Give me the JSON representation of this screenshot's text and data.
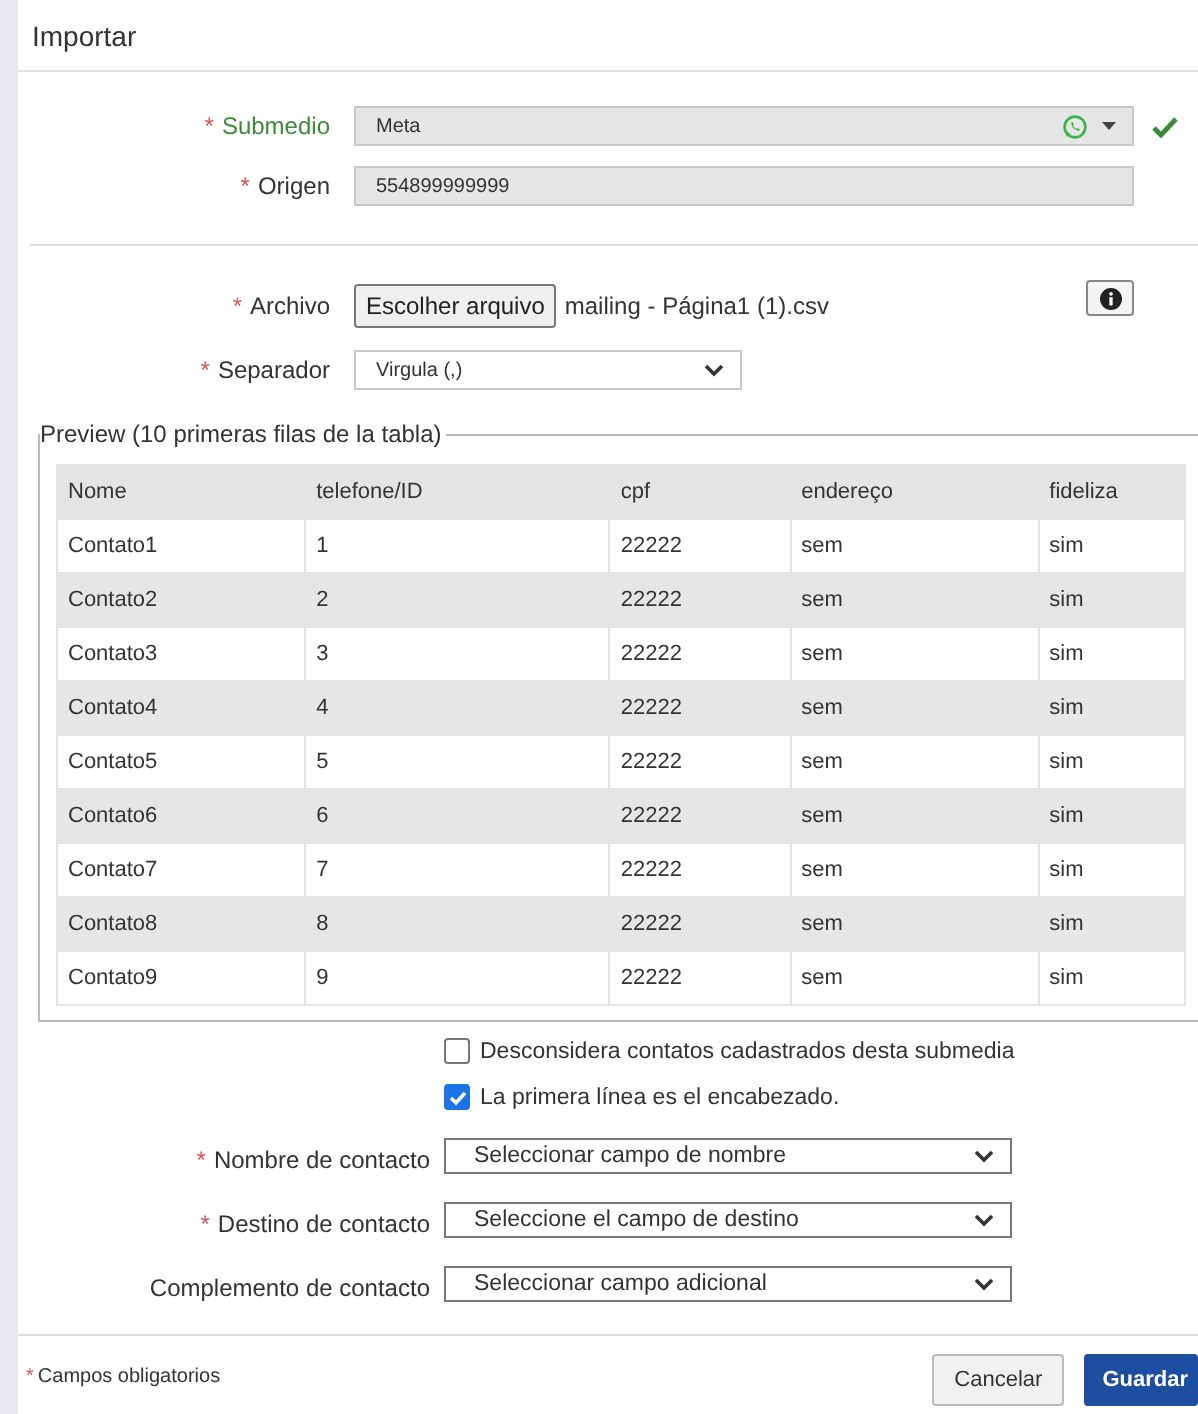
{
  "title": "Importar",
  "submedio": {
    "label": "Submedio",
    "required": true,
    "valid": true,
    "value": "Meta"
  },
  "origen": {
    "label": "Origen",
    "required": true,
    "value": "554899999999"
  },
  "archivo": {
    "label": "Archivo",
    "required": true,
    "button": "Escolher arquivo",
    "file_name": "mailing - Página1 (1).csv"
  },
  "separador": {
    "label": "Separador",
    "required": true,
    "value": "Virgula (,)"
  },
  "preview": {
    "legend": "Preview (10 primeras filas de la tabla)",
    "columns": [
      "Nome",
      "telefone/ID",
      "cpf",
      "endereço",
      "fideliza"
    ],
    "rows": [
      [
        "Contato1",
        "1",
        "22222",
        "sem",
        "sim"
      ],
      [
        "Contato2",
        "2",
        "22222",
        "sem",
        "sim"
      ],
      [
        "Contato3",
        "3",
        "22222",
        "sem",
        "sim"
      ],
      [
        "Contato4",
        "4",
        "22222",
        "sem",
        "sim"
      ],
      [
        "Contato5",
        "5",
        "22222",
        "sem",
        "sim"
      ],
      [
        "Contato6",
        "6",
        "22222",
        "sem",
        "sim"
      ],
      [
        "Contato7",
        "7",
        "22222",
        "sem",
        "sim"
      ],
      [
        "Contato8",
        "8",
        "22222",
        "sem",
        "sim"
      ],
      [
        "Contato9",
        "9",
        "22222",
        "sem",
        "sim"
      ]
    ]
  },
  "options": [
    {
      "label": "Desconsidera contatos cadastrados desta submedia",
      "checked": false
    },
    {
      "label": "La primera línea es el encabezado.",
      "checked": true
    }
  ],
  "mappings": [
    {
      "label": "Nombre de contacto",
      "required": true,
      "value": "Seleccionar campo de nombre"
    },
    {
      "label": "Destino de contacto",
      "required": true,
      "value": "Seleccione el campo de destino"
    },
    {
      "label": "Complemento de contacto",
      "required": false,
      "value": "Seleccionar campo adicional"
    }
  ],
  "footer": {
    "required_mark": "*",
    "note": "Campos obligatorios",
    "buttons": [
      {
        "label": "Cancelar",
        "kind": "secondary"
      },
      {
        "label": "Guardar",
        "kind": "primary"
      }
    ]
  }
}
